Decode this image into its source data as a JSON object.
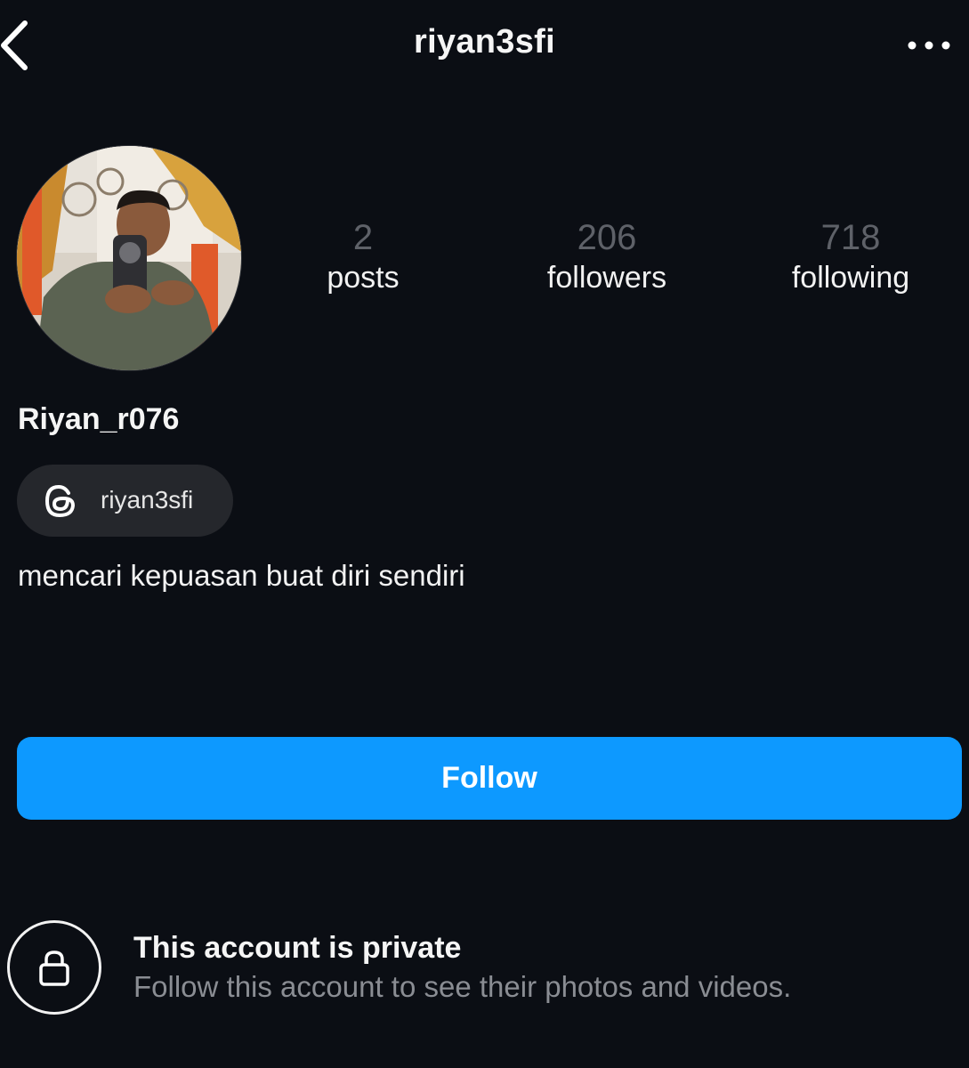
{
  "header": {
    "title": "riyan3sfi",
    "back_icon": "chevron-left-icon",
    "more_icon": "more-horizontal-icon"
  },
  "profile": {
    "display_name": "Riyan_r076",
    "bio": "mencari kepuasan buat diri sendiri"
  },
  "stats": [
    {
      "value": "2",
      "label": "posts"
    },
    {
      "value": "206",
      "label": "followers"
    },
    {
      "value": "718",
      "label": "following"
    }
  ],
  "threads": {
    "icon": "threads-icon",
    "handle": "riyan3sfi"
  },
  "actions": {
    "follow_label": "Follow"
  },
  "private_notice": {
    "icon": "lock-icon",
    "title": "This account is private",
    "subtitle": "Follow this account to see their photos and videos."
  },
  "colors": {
    "background": "#0b0e14",
    "follow_button": "#0d99ff",
    "chip": "#25272c",
    "muted_text": "#8a8d93",
    "stat_number": "#5e6168"
  }
}
